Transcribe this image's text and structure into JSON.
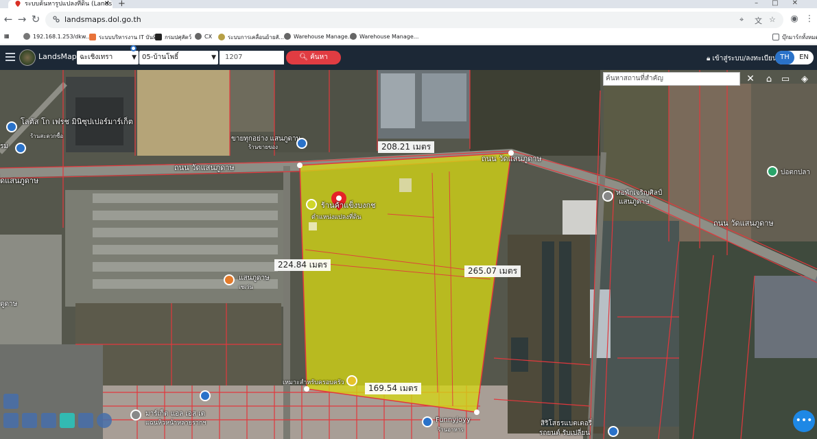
{
  "browser": {
    "tab_title": "ระบบค้นหารูปแปลงที่ดิน (LandsMa",
    "url": "landsmaps.dol.go.th",
    "bookmarks": [
      "192.168.1.253/dkw...",
      "ระบบบริหารงาน IT บันทึ...",
      "กรมปศุสัตว์",
      "CX",
      "ระบบการเคลื่อนย้ายสั...",
      "Warehouse Manage...",
      "Warehouse Manage..."
    ],
    "bookmarks_folder": "บุ๊กมาร์กทั้งหมด"
  },
  "header": {
    "brand": "LandsMaps",
    "province": "ฉะเชิงเทรา",
    "district": "05-บ้านโพธิ์",
    "parcel_number": "1207",
    "search_label": "ค้นหา",
    "login_label": "เข้าสู่ระบบ/ลงทะเบียน",
    "lang_th": "TH",
    "lang_en": "EN"
  },
  "map": {
    "search_placeholder": "ค้นหาสถานที่สำคัญ",
    "distances": {
      "top": "208.21 เมตร",
      "left": "224.84 เมตร",
      "right": "265.07 เมตร",
      "bottom": "169.54 เมตร"
    },
    "roads": {
      "left": "ถนน วัดแสนภูดาษ",
      "left_edge": "ดแสนภูดาษ",
      "middle": "ถนน วัดแสนภูดาษ",
      "right": "ถนน วัดแสนภูดาษ"
    },
    "places": {
      "parcel_label": "ร้านค้าแข็งบงกช",
      "parcel_sub": "ตำแหน่งแปลงที่ดิน",
      "shop_top": "ขายทุกอย่าง แสนภูดาษ",
      "shop_top_sub": "ร้านขายของ",
      "dorm": "หอพักเจริญศิลป์",
      "dorm_sub": "แสนภูดาษ",
      "poi_left": "แสนภูดาษ",
      "poi_left_sub": "เซเว่น",
      "lotus": "โลตัส โก เฟรช มินิซุปเปอร์มาร์เก็ต",
      "lotus_sub": "ร้านสะดวกซื้อ",
      "bottom_label": "เหมาะสำหรับครอบครัว",
      "bottom_left": "มาร์เก็ต แอล เอส เต",
      "bottom_left_sub": "แฉนหิวหน้าหลายรากฯ",
      "funny": "Funnyjoyy",
      "funny_sub": "ร้านอาหาร",
      "car": "สิริโสธรแบตเตอรี่",
      "car_sub": "รถยนต์ รับเปลี่ยน",
      "right_edge": "บ่อตกปลา",
      "left_edge": "ดูดาษ",
      "left_edge2": "รม"
    }
  }
}
